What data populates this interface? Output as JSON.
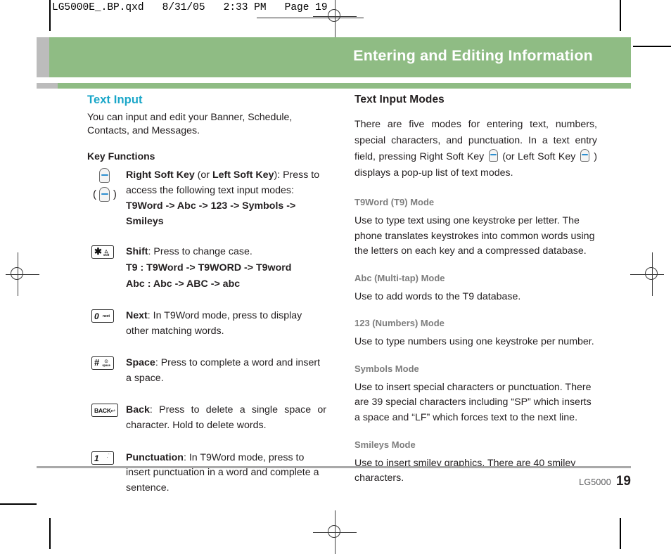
{
  "print_marks": {
    "file_header": "LG5000E_.BP.qxd   8/31/05   2:33 PM   Page 19"
  },
  "banner": {
    "title": "Entering and Editing Information",
    "bg_color": "#8fbc84",
    "tab_color": "#bcbcbc",
    "text_color": "#ffffff"
  },
  "left_column": {
    "heading": "Text Input",
    "heading_color": "#19a6c8",
    "intro": "You can input and edit your Banner, Schedule, Contacts, and Messages.",
    "key_functions_heading": "Key Functions",
    "rows": [
      {
        "icon": "soft-key-icon",
        "term": "Right Soft Key",
        "term_alt_prefix": " (or ",
        "term_alt": "Left Soft Key",
        "term_alt_suffix": "): Press to",
        "desc": "access the following text input modes:",
        "sequence": "T9Word -> Abc -> 123 -> Symbols -> Smileys"
      },
      {
        "icon": "star-shift-key-icon",
        "icon_big": "✱",
        "icon_sub": "shift",
        "term": "Shift",
        "desc": ": Press to change case.",
        "sequence": "T9 : T9Word -> T9WORD -> T9word",
        "sequence2": "Abc : Abc -> ABC -> abc"
      },
      {
        "icon": "zero-next-key-icon",
        "icon_big": "0",
        "icon_sub": "next",
        "term": "Next",
        "desc": ": In T9Word mode, press to display other matching words."
      },
      {
        "icon": "hash-space-key-icon",
        "icon_big": "#",
        "icon_sub": "space",
        "term": "Space",
        "desc": ": Press to complete a word and insert a space."
      },
      {
        "icon": "back-key-icon",
        "icon_big": "BACK",
        "icon_sub": "↩",
        "term": "Back",
        "desc": ": Press to delete a single space or character. Hold to delete words."
      },
      {
        "icon": "one-punctuation-key-icon",
        "icon_big": "1",
        "icon_sub": ".˙˙",
        "term": "Punctuation",
        "desc": ": In T9Word mode, press to insert punctuation in a word and complete a sentence."
      }
    ]
  },
  "right_column": {
    "heading": "Text Input Modes",
    "intro_part1": "There are five modes for entering text, numbers, special characters, and punctuation. In a text entry field, pressing Right Soft Key ",
    "intro_part2": " (or Left Soft Key ",
    "intro_part3": " ) displays a pop-up list of text modes.",
    "modes": [
      {
        "title": "T9Word (T9) Mode",
        "body": "Use to type text using one keystroke per letter. The phone translates keystrokes into common words using the letters on each key and a compressed database."
      },
      {
        "title": "Abc (Multi-tap) Mode",
        "body": "Use to add words to the T9 database."
      },
      {
        "title": "123 (Numbers) Mode",
        "body": "Use to type numbers using one keystroke per number."
      },
      {
        "title": "Symbols Mode",
        "body": "Use to insert special characters or punctuation. There are 39 special characters including “SP” which inserts a space and “LF” which forces text to the next line."
      },
      {
        "title": "Smileys Mode",
        "body": "Use to insert smiley graphics. There are 40 smiley characters."
      }
    ]
  },
  "footer": {
    "brand": "LG5000",
    "page_number": "19"
  }
}
